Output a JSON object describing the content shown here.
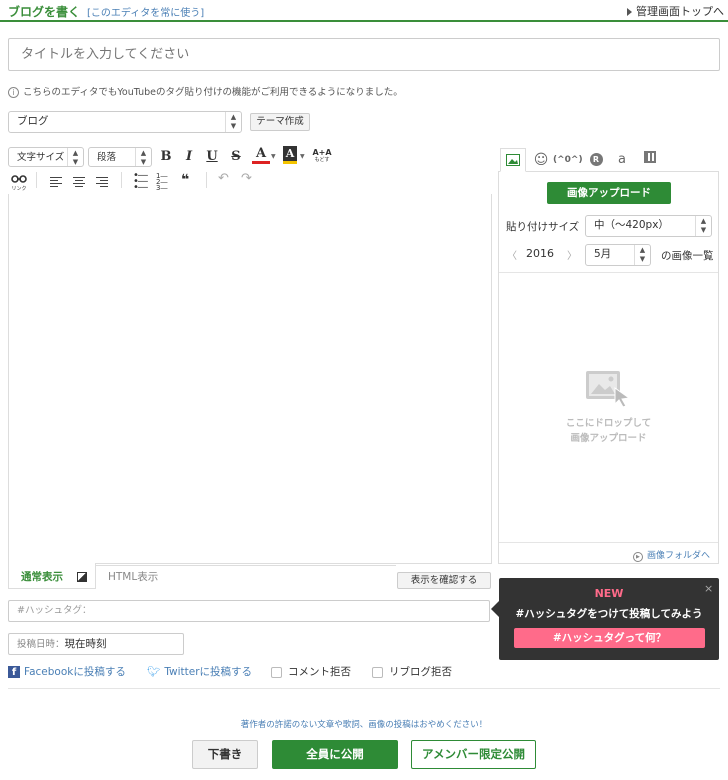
{
  "header": {
    "title": "ブログを書く",
    "editor_toggle": "[このエディタを常に使う]",
    "admin_link": "管理画面トップへ"
  },
  "title_input": {
    "placeholder": "タイトルを入力してください"
  },
  "notice": "こちらのエディタでもYouTubeのタグ貼り付けの機能がご利用できるようになりました。",
  "category": {
    "selected": "ブログ",
    "theme_button": "テーマ作成"
  },
  "toolbar": {
    "font_size": "文字サイズ",
    "paragraph": "段落",
    "bold": "B",
    "italic": "I",
    "underline": "U",
    "strike": "S",
    "text_color": "A",
    "bg_color": "A",
    "format_reset": "A+A",
    "format_reset_sub": "もどす",
    "link_label": "リンク",
    "quote": "❝"
  },
  "sidebar": {
    "emoticon_tab": "(^0^)",
    "upload_button": "画像アップロード",
    "paste_size_label": "貼り付けサイズ",
    "paste_size_value": "中（〜420px）",
    "year": "2016",
    "month": "5月",
    "image_list_label": "の画像一覧",
    "drop_text_1": "ここにドロップして",
    "drop_text_2": "画像アップロード",
    "image_folder_link": "画像フォルダへ"
  },
  "tabs": {
    "normal": "通常表示",
    "html": "HTML表示",
    "preview_button": "表示を確認する"
  },
  "hashtag": {
    "placeholder": "#ハッシュタグ："
  },
  "post_date": {
    "label": "投稿日時：",
    "value": "現在時刻"
  },
  "share": {
    "facebook": "Facebookに投稿する",
    "twitter": "Twitterに投稿する",
    "no_comment": "コメント拒否",
    "no_reblog": "リブログ拒否"
  },
  "popup": {
    "badge": "NEW",
    "text": "#ハッシュタグをつけて投稿してみよう",
    "button": "#ハッシュタグって何？",
    "close": "×"
  },
  "footer": {
    "note": "著作者の許諾のない文章や歌詞、画像の投稿はおやめください！",
    "draft": "下書き",
    "publish": "全員に公開",
    "amember": "アメンバー限定公開"
  },
  "colors": {
    "accent": "#3a8e3a",
    "button_green": "#2e8b36",
    "link": "#4a7fb5",
    "popup_pink": "#ff6b8a"
  }
}
